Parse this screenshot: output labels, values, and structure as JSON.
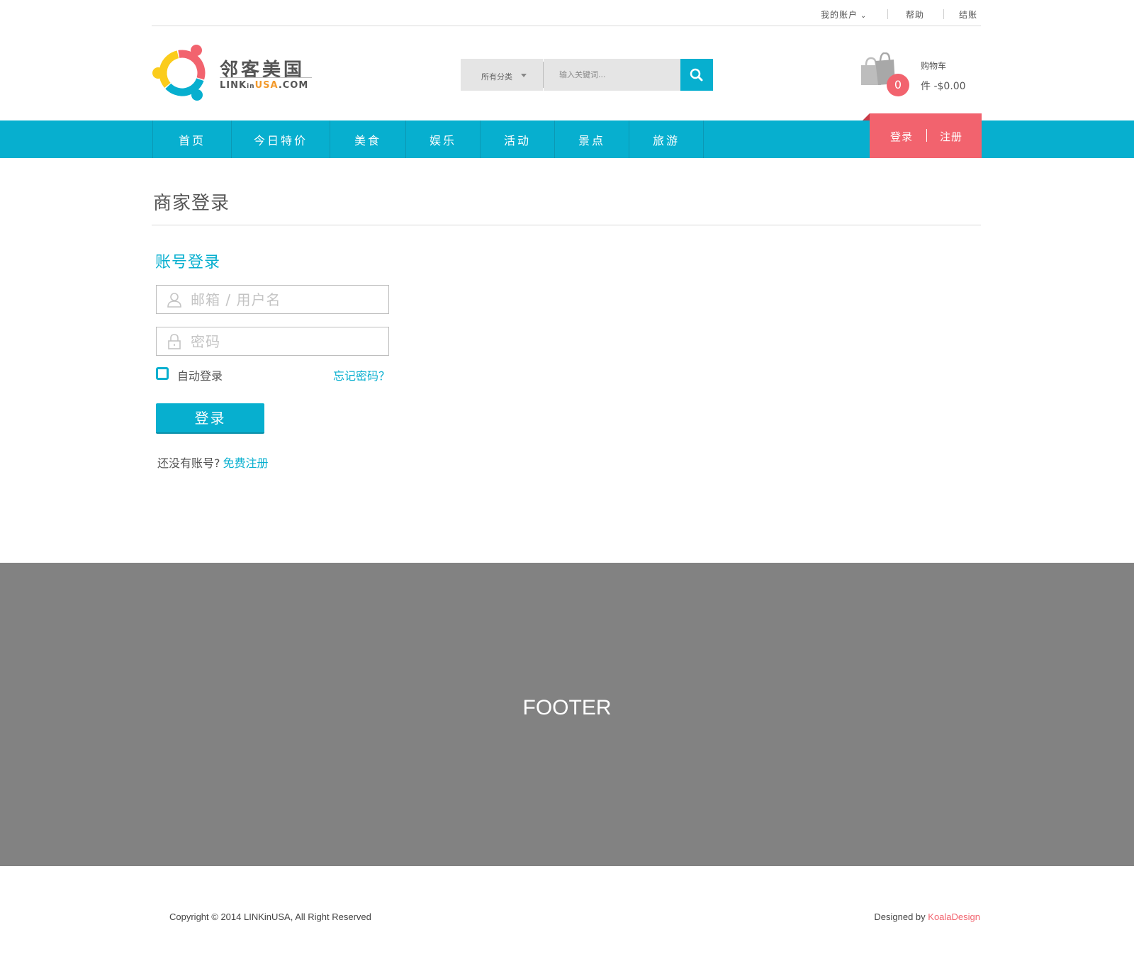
{
  "topbar": {
    "account": "我的账户",
    "help": "帮助",
    "checkout": "结账"
  },
  "logo": {
    "name_cn": "邻客美国",
    "name_en_prefix": "LINKinUSA",
    "name_en_prefix_plain": "LINK",
    "name_en_in": "in",
    "name_en_usa": "USA",
    "name_en_suffix": ".COM",
    "colors": [
      "#f2636e",
      "#fbcc1c",
      "#07afcf",
      "#555555"
    ]
  },
  "search": {
    "category_label": "所有分类",
    "placeholder": "输入关键词...",
    "button_icon": "search-icon"
  },
  "cart": {
    "title": "购物车",
    "count": "0",
    "summary": "件 -$0.00",
    "icon": "shopping-bag-icon"
  },
  "nav": {
    "items": [
      "首页",
      "今日特价",
      "美食",
      "娱乐",
      "活动",
      "景点",
      "旅游"
    ]
  },
  "auth": {
    "login": "登录",
    "register": "注册"
  },
  "page": {
    "title": "商家登录"
  },
  "login_form": {
    "heading": "账号登录",
    "username_placeholder": "邮箱 / 用户名",
    "password_placeholder": "密码",
    "remember_label": "自动登录",
    "forgot_label": "忘记密码？",
    "submit_label": "登录",
    "no_account_text": "还没有账号?",
    "register_link": "免费注册"
  },
  "footer": {
    "placeholder_text": "FOOTER",
    "copyright": "Copyright © 2014 LINKinUSA,  All Right Reserved",
    "designed_by": "Designed by ",
    "designer": "KoalaDesign"
  },
  "colors": {
    "primary": "#07afcf",
    "accent": "#f2636e",
    "footer_bg": "#828282"
  }
}
